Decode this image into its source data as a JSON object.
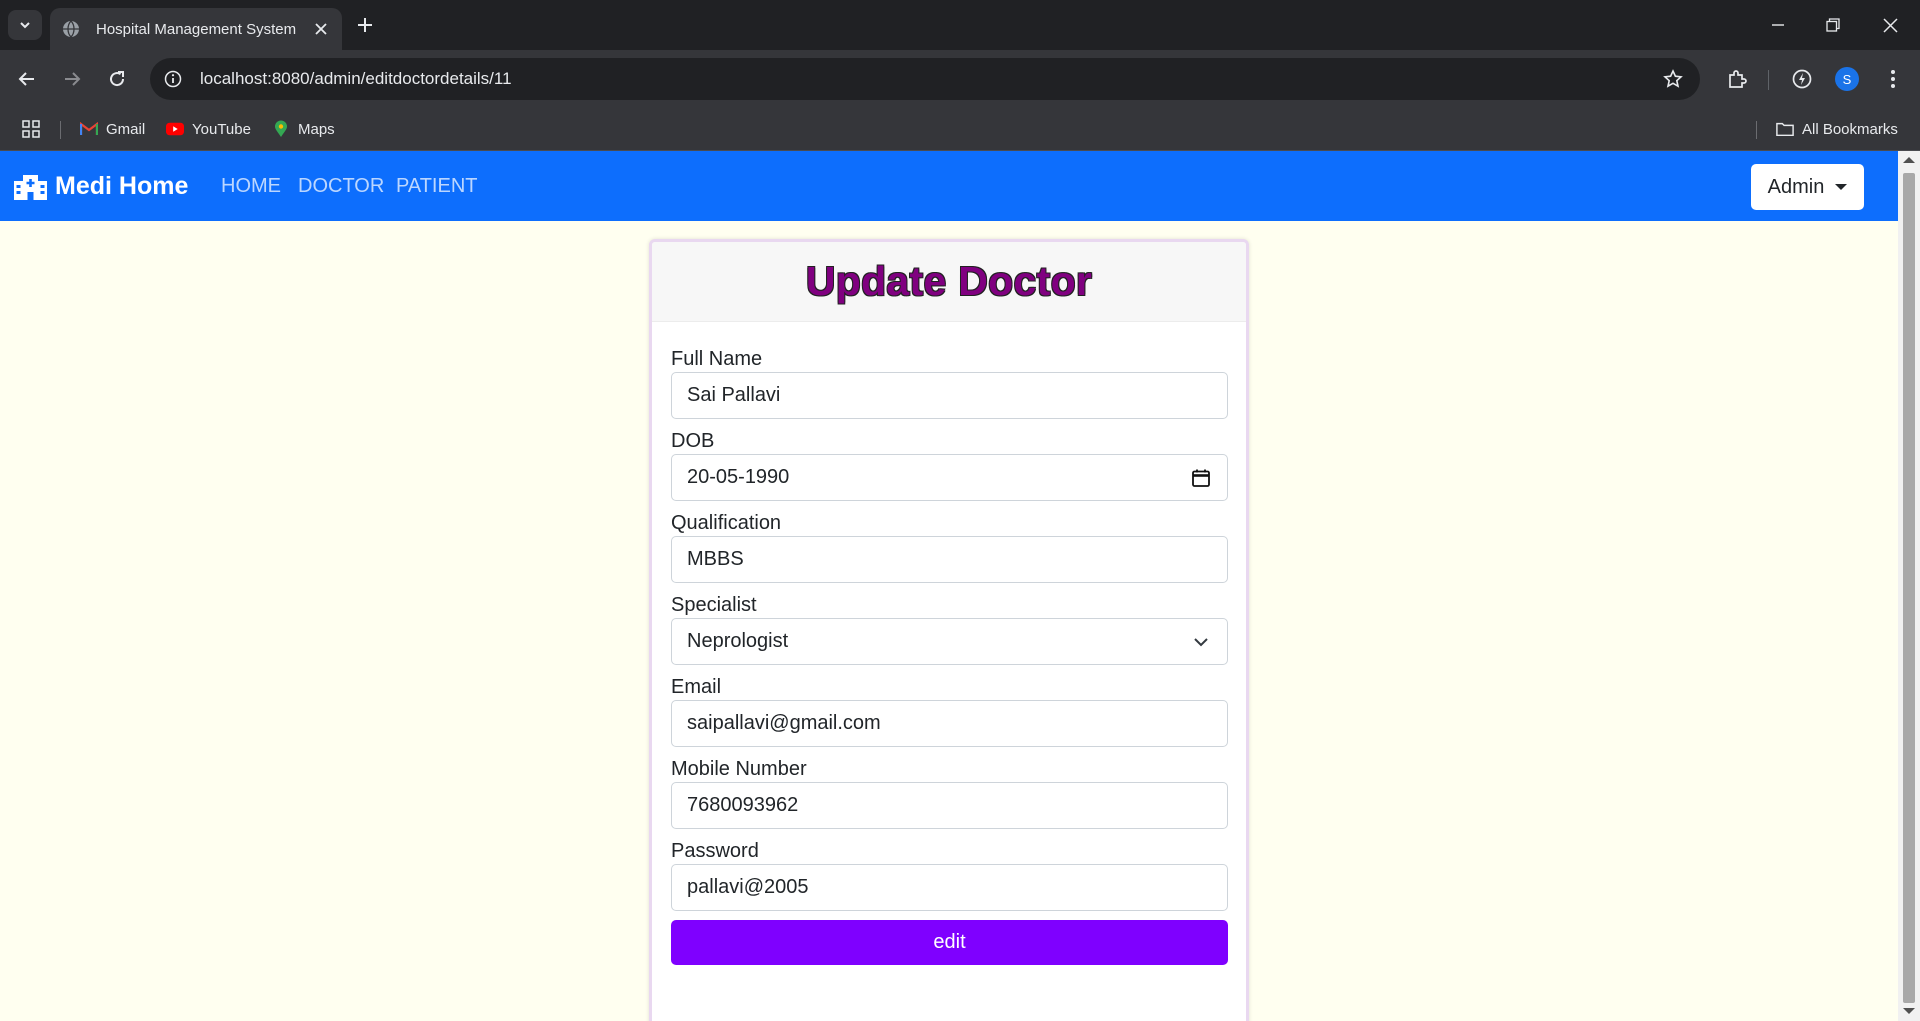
{
  "browser": {
    "tab_title": "Hospital Management System",
    "url": "localhost:8080/admin/editdoctordetails/11",
    "profile_initial": "S",
    "bookmarks": [
      {
        "label": "Gmail",
        "icon": "gmail-icon"
      },
      {
        "label": "YouTube",
        "icon": "youtube-icon"
      },
      {
        "label": "Maps",
        "icon": "maps-icon"
      }
    ],
    "all_bookmarks": "All Bookmarks"
  },
  "navbar": {
    "brand": "Medi Home",
    "links": [
      "HOME",
      "DOCTOR",
      "PATIENT"
    ],
    "admin_menu": "Admin",
    "color": "#0d6efd"
  },
  "form": {
    "title": "Update Doctor",
    "fields": [
      {
        "label": "Full Name",
        "value": "Sai Pallavi"
      },
      {
        "label": "DOB",
        "value": "20-05-1990"
      },
      {
        "label": "Qualification",
        "value": "MBBS"
      },
      {
        "label": "Specialist",
        "value": "Neprologist"
      },
      {
        "label": "Email",
        "value": "saipallavi@gmail.com"
      },
      {
        "label": "Mobile Number",
        "value": "7680093962"
      },
      {
        "label": "Password",
        "value": "pallavi@2005"
      }
    ],
    "submit_label": "edit",
    "title_color": "#800080",
    "button_color": "#7f00ff",
    "page_background": "#fffff0"
  }
}
